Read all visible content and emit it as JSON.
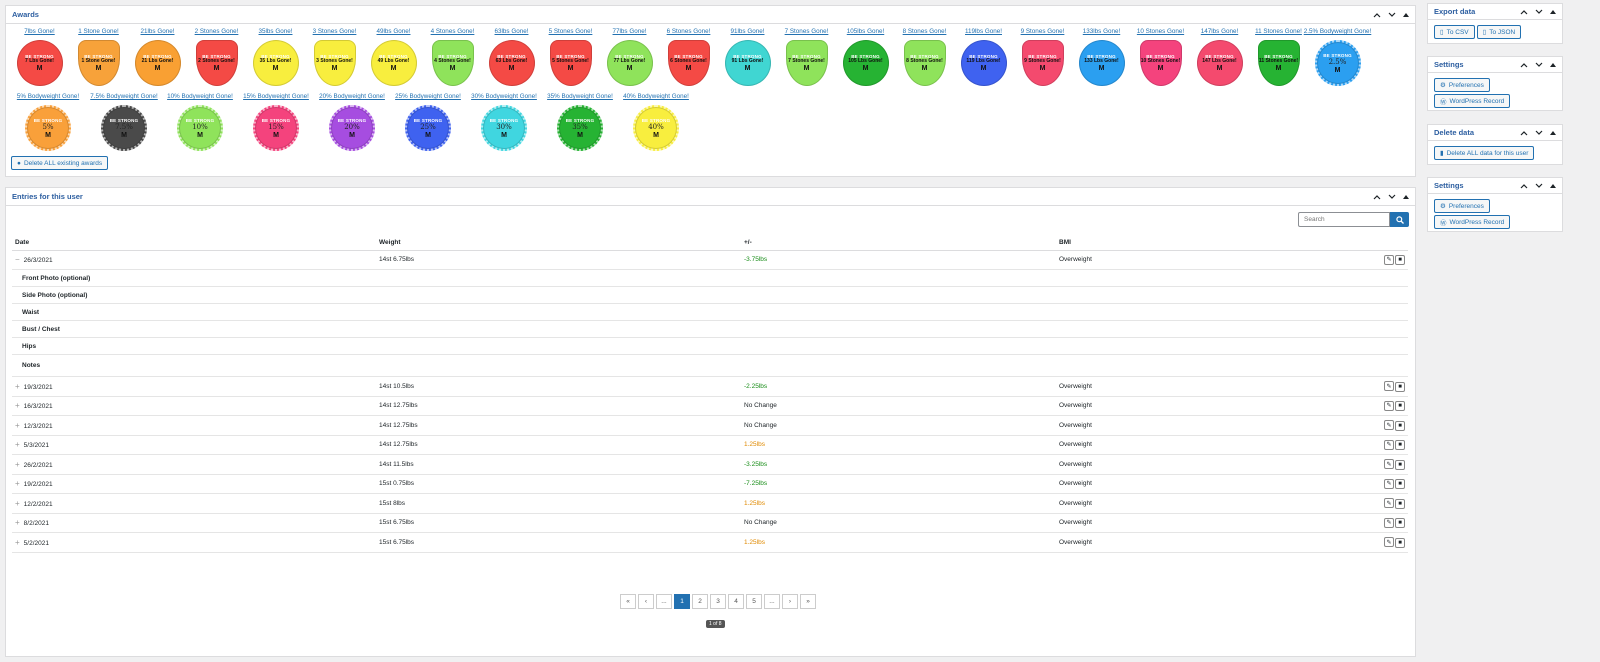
{
  "awards_panel": {
    "title": "Awards",
    "row1": [
      {
        "label": "7lbs Gone!",
        "top": "BE STRONG",
        "mid": "7 Lbs Gone!",
        "bg": "#f44a45",
        "shape": "circle"
      },
      {
        "label": "1 Stone Gone!",
        "top": "BE STRONG",
        "mid": "1 Stone Gone!",
        "bg": "#f7a23a",
        "shape": "shield"
      },
      {
        "label": "21lbs Gone!",
        "top": "BE STRONG",
        "mid": "21 Lbs Gone!",
        "bg": "#f9a033",
        "shape": "circle"
      },
      {
        "label": "2 Stones Gone!",
        "top": "BE STRONG",
        "mid": "2 Stones Gone!",
        "bg": "#f44a45",
        "shape": "shield"
      },
      {
        "label": "35lbs Gone!",
        "top": "BE STRONG",
        "mid": "35 Lbs Gone!",
        "bg": "#f8ee3e",
        "shape": "circle"
      },
      {
        "label": "3 Stones Gone!",
        "top": "BE STRONG",
        "mid": "3 Stones Gone!",
        "bg": "#f8ee3e",
        "shape": "shield"
      },
      {
        "label": "49lbs Gone!",
        "top": "BE STRONG",
        "mid": "49 Lbs Gone!",
        "bg": "#f8ee3e",
        "shape": "circle"
      },
      {
        "label": "4 Stones Gone!",
        "top": "BE STRONG",
        "mid": "4 Stones Gone!",
        "bg": "#8fe35b",
        "shape": "shield"
      },
      {
        "label": "63lbs Gone!",
        "top": "BE STRONG",
        "mid": "63 Lbs Gone!",
        "bg": "#f44a45",
        "shape": "circle"
      },
      {
        "label": "5 Stones Gone!",
        "top": "BE STRONG",
        "mid": "5 Stones Gone!",
        "bg": "#f44a45",
        "shape": "shield"
      },
      {
        "label": "77lbs Gone!",
        "top": "BE STRONG",
        "mid": "77 Lbs Gone!",
        "bg": "#8fe35b",
        "shape": "circle"
      },
      {
        "label": "6 Stones Gone!",
        "top": "BE STRONG",
        "mid": "6 Stones Gone!",
        "bg": "#f44a45",
        "shape": "shield"
      },
      {
        "label": "91lbs Gone!",
        "top": "BE STRONG",
        "mid": "91 Lbs Gone!",
        "bg": "#40d6d2",
        "shape": "circle"
      },
      {
        "label": "7 Stones Gone!",
        "top": "BE STRONG",
        "mid": "7 Stones Gone!",
        "bg": "#8fe35b",
        "shape": "shield"
      },
      {
        "label": "105lbs Gone!",
        "top": "BE STRONG",
        "mid": "105 Lbs Gone!",
        "bg": "#26b333",
        "shape": "circle"
      },
      {
        "label": "8 Stones Gone!",
        "top": "BE STRONG",
        "mid": "8 Stones Gone!",
        "bg": "#8fe35b",
        "shape": "shield"
      },
      {
        "label": "119lbs Gone!",
        "top": "BE STRONG",
        "mid": "119 Lbs Gone!",
        "bg": "#3f62f0",
        "shape": "circle"
      },
      {
        "label": "9 Stones Gone!",
        "top": "BE STRONG",
        "mid": "9 Stones Gone!",
        "bg": "#f44a6e",
        "shape": "shield"
      },
      {
        "label": "133lbs Gone!",
        "top": "BE STRONG",
        "mid": "133 Lbs Gone!",
        "bg": "#2b9ff0",
        "shape": "circle"
      },
      {
        "label": "10 Stones Gone!",
        "top": "BE STRONG",
        "mid": "10 Stones Gone!",
        "bg": "#f4437d",
        "shape": "shield"
      },
      {
        "label": "147lbs Gone!",
        "top": "BE STRONG",
        "mid": "147 Lbs Gone!",
        "bg": "#f44a6e",
        "shape": "circle"
      },
      {
        "label": "11 Stones Gone!",
        "top": "BE STRONG",
        "mid": "11 Stones Gone!",
        "bg": "#26b333",
        "shape": "shield"
      },
      {
        "label": "2.5% Bodyweight Gone!",
        "top": "BE STRONG",
        "mid": "2.5%",
        "bg": "#2b9ff0",
        "shape": "dotted"
      }
    ],
    "row2": [
      {
        "label": "5% Bodyweight Gone!",
        "top": "BE STRONG",
        "mid": "5%",
        "bg": "#f9a03a"
      },
      {
        "label": "7.5% Bodyweight Gone!",
        "top": "BE STRONG",
        "mid": "7.5%",
        "bg": "#4a4a4a"
      },
      {
        "label": "10% Bodyweight Gone!",
        "top": "BE STRONG",
        "mid": "10%",
        "bg": "#8fe35b"
      },
      {
        "label": "15% Bodyweight Gone!",
        "top": "BE STRONG",
        "mid": "15%",
        "bg": "#f4437d"
      },
      {
        "label": "20% Bodyweight Gone!",
        "top": "BE STRONG",
        "mid": "20%",
        "bg": "#a64de0"
      },
      {
        "label": "25% Bodyweight Gone!",
        "top": "BE STRONG",
        "mid": "25%",
        "bg": "#3f62f0"
      },
      {
        "label": "30% Bodyweight Gone!",
        "top": "BE STRONG",
        "mid": "30%",
        "bg": "#40d6e0"
      },
      {
        "label": "35% Bodyweight Gone!",
        "top": "BE STRONG",
        "mid": "35%",
        "bg": "#26b333"
      },
      {
        "label": "40% Bodyweight Gone!",
        "top": "BE STRONG",
        "mid": "40%",
        "bg": "#f8ee3e"
      }
    ],
    "delete_button": "Delete ALL existing awards"
  },
  "entries_panel": {
    "title": "Entries for this user",
    "search_placeholder": "Search",
    "columns": [
      "Date",
      "Weight",
      "+/-",
      "BMI"
    ],
    "expanded_row": {
      "date": "26/3/2021",
      "weight": "14st 6.75lbs",
      "change": "-3.75lbs",
      "bmi": "Overweight",
      "change_type": "green"
    },
    "detail_fields": [
      "Front Photo (optional)",
      "Side Photo (optional)",
      "Waist",
      "Bust / Chest",
      "Hips",
      "Notes"
    ],
    "rows": [
      {
        "date": "19/3/2021",
        "weight": "14st 10.5lbs",
        "change": "-2.25lbs",
        "bmi": "Overweight",
        "change_type": "green"
      },
      {
        "date": "16/3/2021",
        "weight": "14st 12.75lbs",
        "change": "No Change",
        "bmi": "Overweight",
        "change_type": "none"
      },
      {
        "date": "12/3/2021",
        "weight": "14st 12.75lbs",
        "change": "No Change",
        "bmi": "Overweight",
        "change_type": "none"
      },
      {
        "date": "5/3/2021",
        "weight": "14st 12.75lbs",
        "change": "1.25lbs",
        "bmi": "Overweight",
        "change_type": "orange"
      },
      {
        "date": "26/2/2021",
        "weight": "14st 11.5lbs",
        "change": "-3.25lbs",
        "bmi": "Overweight",
        "change_type": "green"
      },
      {
        "date": "19/2/2021",
        "weight": "15st 0.75lbs",
        "change": "-7.25lbs",
        "bmi": "Overweight",
        "change_type": "green"
      },
      {
        "date": "12/2/2021",
        "weight": "15st 8lbs",
        "change": "1.25lbs",
        "bmi": "Overweight",
        "change_type": "orange"
      },
      {
        "date": "8/2/2021",
        "weight": "15st 6.75lbs",
        "change": "No Change",
        "bmi": "Overweight",
        "change_type": "none"
      },
      {
        "date": "5/2/2021",
        "weight": "15st 6.75lbs",
        "change": "1.25lbs",
        "bmi": "Overweight",
        "change_type": "orange"
      }
    ],
    "pagination": [
      "«",
      "‹",
      "...",
      "1",
      "2",
      "3",
      "4",
      "5",
      "...",
      "›",
      "»"
    ],
    "active_page": "1",
    "page_info": "1 of 8"
  },
  "sidebar": {
    "export": {
      "title": "Export data",
      "buttons": [
        "To CSV",
        "To JSON"
      ]
    },
    "settings1": {
      "title": "Settings",
      "buttons": [
        "Preferences",
        "WordPress Record"
      ]
    },
    "delete": {
      "title": "Delete data",
      "buttons": [
        "Delete ALL data for this user"
      ]
    },
    "settings2": {
      "title": "Settings",
      "buttons": [
        "Preferences",
        "WordPress Record"
      ]
    }
  },
  "colors": {
    "accent": "#2271b1",
    "positive": "#1a8e1a",
    "negative": "#e08a00"
  }
}
